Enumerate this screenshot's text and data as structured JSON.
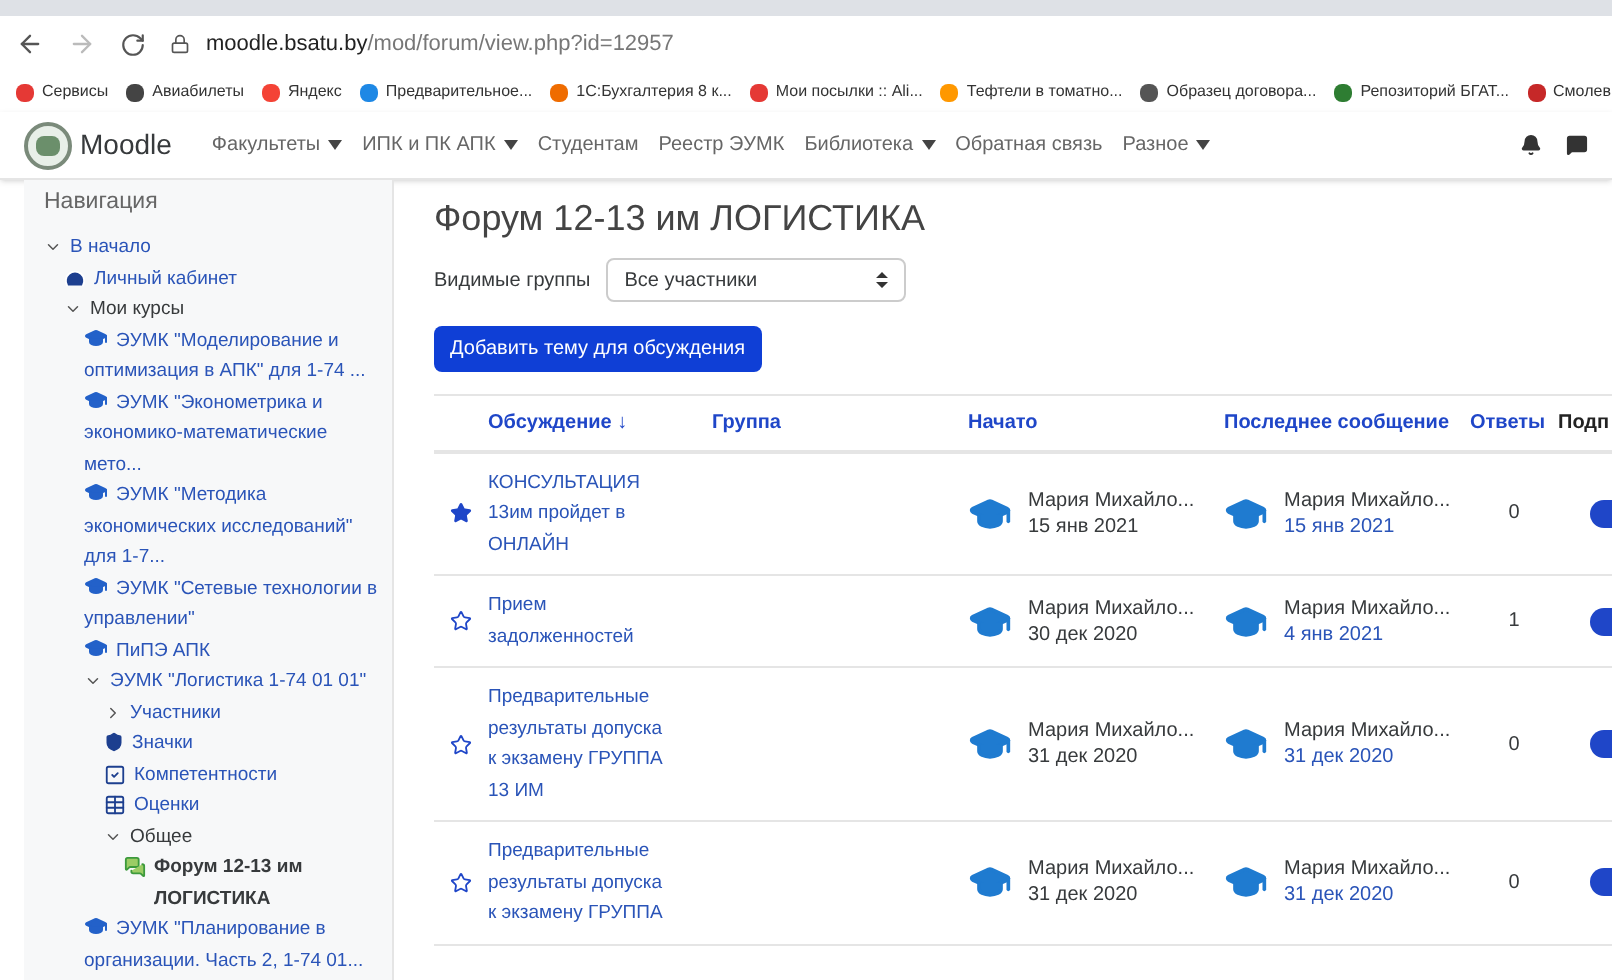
{
  "browser": {
    "url_host": "moodle.bsatu.by",
    "url_path": "/mod/forum/view.php?id=12957"
  },
  "bookmarks": [
    {
      "label": "Сервисы",
      "color": "#e53935"
    },
    {
      "label": "Авиабилеты",
      "color": "#444444"
    },
    {
      "label": "Яндекс",
      "color": "#f44336"
    },
    {
      "label": "Предварительное...",
      "color": "#1e88e5"
    },
    {
      "label": "1С:Бухгалтерия 8 к...",
      "color": "#ef6c00"
    },
    {
      "label": "Мои посылки :: Ali...",
      "color": "#e53935"
    },
    {
      "label": "Тефтели в томатно...",
      "color": "#ff9800"
    },
    {
      "label": "Образец договора...",
      "color": "#555555"
    },
    {
      "label": "Репозиторий БГАТ...",
      "color": "#2e7d32"
    },
    {
      "label": "Смолев",
      "color": "#c62828"
    }
  ],
  "navbar": {
    "brand": "Moodle",
    "items": [
      {
        "label": "Факультеты",
        "dropdown": true
      },
      {
        "label": "ИПК и ПК АПК",
        "dropdown": true
      },
      {
        "label": "Студентам",
        "dropdown": false
      },
      {
        "label": "Реестр ЭУМК",
        "dropdown": false
      },
      {
        "label": "Библиотека",
        "dropdown": true
      },
      {
        "label": "Обратная связь",
        "dropdown": false
      },
      {
        "label": "Разное",
        "dropdown": true
      }
    ]
  },
  "sidebar": {
    "title": "Навигация",
    "items": [
      {
        "label": "В начало",
        "kind": "link",
        "expanded": true,
        "children": [
          {
            "label": "Личный кабинет",
            "kind": "dashboard"
          },
          {
            "label": "Мои курсы",
            "kind": "folder",
            "expanded": true,
            "children": [
              {
                "label": "ЭУМК \"Моделирование и оптимизация в АПК\" для 1-74 ...",
                "kind": "course"
              },
              {
                "label": "ЭУМК \"Эконометрика и экономико-математические мето...",
                "kind": "course"
              },
              {
                "label": "ЭУМК \"Методика экономических исследований\" для 1-7...",
                "kind": "course"
              },
              {
                "label": "ЭУМК \"Сетевые технологии в управлении\"",
                "kind": "course"
              },
              {
                "label": "ПиПЭ АПК",
                "kind": "course"
              },
              {
                "label": "ЭУМК \"Логистика 1-74 01 01\"",
                "kind": "link",
                "expanded": true,
                "children": [
                  {
                    "label": "Участники",
                    "kind": "link",
                    "expanded": false
                  },
                  {
                    "label": "Значки",
                    "kind": "shield"
                  },
                  {
                    "label": "Компетентности",
                    "kind": "check"
                  },
                  {
                    "label": "Оценки",
                    "kind": "table"
                  },
                  {
                    "label": "Общее",
                    "kind": "folder",
                    "expanded": true,
                    "children": [
                      {
                        "label": "Форум 12-13 им ЛОГИСТИКА",
                        "kind": "forum",
                        "selected": true
                      }
                    ]
                  }
                ]
              },
              {
                "label": "ЭУМК \"Планирование в организации. Часть 2, 1-74 01...",
                "kind": "course"
              }
            ]
          }
        ]
      }
    ]
  },
  "page": {
    "title": "Форум 12-13 им ЛОГИСТИКА",
    "group_label": "Видимые группы",
    "group_value": "Все участники",
    "add_button": "Добавить тему для обсуждения"
  },
  "table": {
    "columns": [
      {
        "label": "Обсуждение ↓",
        "link": true
      },
      {
        "label": "Группа",
        "link": true
      },
      {
        "label": "Начато",
        "link": true
      },
      {
        "label": "Последнее сообщение",
        "link": true
      },
      {
        "label": "Ответы",
        "link": true
      },
      {
        "label": "Подп",
        "link": false
      }
    ],
    "rows": [
      {
        "starred": true,
        "title": "КОНСУЛЬТАЦИЯ 13им пройдет в ОНЛАЙН",
        "started_by": "Мария Михайло...",
        "started": "15 янв 2021",
        "last_by": "Мария Михайло...",
        "last": "15 янв 2021",
        "replies": "0",
        "subscribed": true
      },
      {
        "starred": false,
        "title": "Прием задолженностей",
        "started_by": "Мария Михайло...",
        "started": "30 дек 2020",
        "last_by": "Мария Михайло...",
        "last": "4 янв 2021",
        "replies": "1",
        "subscribed": true
      },
      {
        "starred": false,
        "title": "Предварительные результаты допуска к экзамену ГРУППА 13 ИМ",
        "started_by": "Мария Михайло...",
        "started": "31 дек 2020",
        "last_by": "Мария Михайло...",
        "last": "31 дек 2020",
        "replies": "0",
        "subscribed": true
      },
      {
        "starred": false,
        "title": "Предварительные результаты допуска к экзамену ГРУППА",
        "started_by": "Мария Михайло...",
        "started": "31 дек 2020",
        "last_by": "Мария Михайло...",
        "last": "31 дек 2020",
        "replies": "0",
        "subscribed": true
      }
    ]
  }
}
